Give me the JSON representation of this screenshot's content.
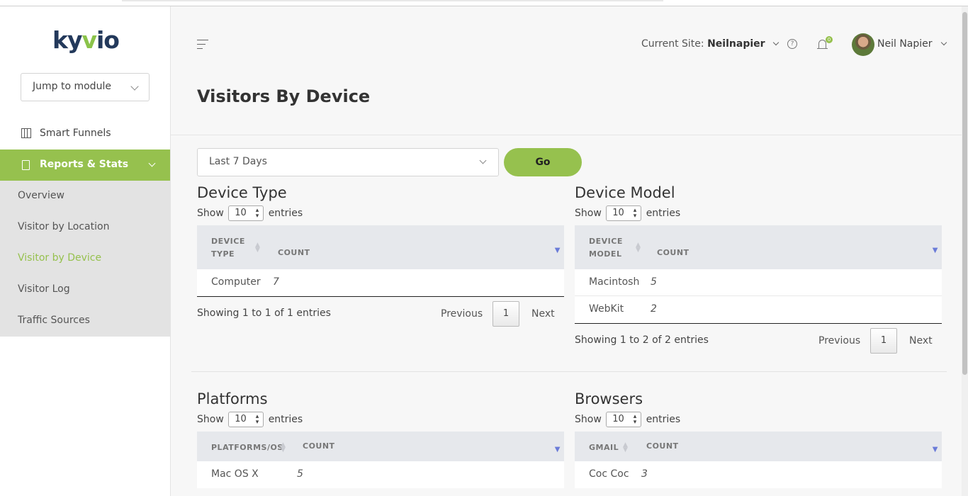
{
  "app": {
    "logo_prefix": "ky",
    "logo_v": "v",
    "logo_suffix": "io"
  },
  "sidebar": {
    "jump_placeholder": "Jump to module",
    "funnels_label": "Smart Funnels",
    "reports_label": "Reports & Stats",
    "subitems": [
      {
        "label": "Overview"
      },
      {
        "label": "Visitor by Location"
      },
      {
        "label": "Visitor by Device"
      },
      {
        "label": "Visitor Log"
      },
      {
        "label": "Traffic Sources"
      }
    ]
  },
  "header": {
    "site_label": "Current Site:",
    "site_value": "Neilnapier",
    "help_glyph": "?",
    "notification_count": "0",
    "user_name": "Neil Napier"
  },
  "page": {
    "title": "Visitors By Device",
    "range_value": "Last 7 Days",
    "go_label": "Go"
  },
  "common": {
    "show": "Show",
    "entries": "entries",
    "page_size": "10",
    "previous": "Previous",
    "next": "Next",
    "current_page": "1"
  },
  "device_type": {
    "title": "Device Type",
    "col1_line1": "DEVICE",
    "col1_line2": "TYPE",
    "col2": "COUNT",
    "rows": [
      {
        "name": "Computer",
        "count": "7"
      }
    ],
    "info": "Showing 1 to 1 of 1 entries"
  },
  "device_model": {
    "title": "Device Model",
    "col1_line1": "DEVICE",
    "col1_line2": "MODEL",
    "col2": "COUNT",
    "rows": [
      {
        "name": "Macintosh",
        "count": "5"
      },
      {
        "name": "WebKit",
        "count": "2"
      }
    ],
    "info": "Showing 1 to 2 of 2 entries"
  },
  "platforms": {
    "title": "Platforms",
    "col1": "PLATFORMS/OS",
    "col2": "COUNT",
    "rows": [
      {
        "name": "Mac OS X",
        "count": "5"
      }
    ]
  },
  "browsers": {
    "title": "Browsers",
    "col1": "GMAIL",
    "col2": "COUNT",
    "rows": [
      {
        "name": "Coc Coc",
        "count": "3"
      }
    ]
  },
  "colors": {
    "accent": "#96c14e",
    "brand_navy": "#23395b",
    "sort_active": "#6a7bd8"
  }
}
